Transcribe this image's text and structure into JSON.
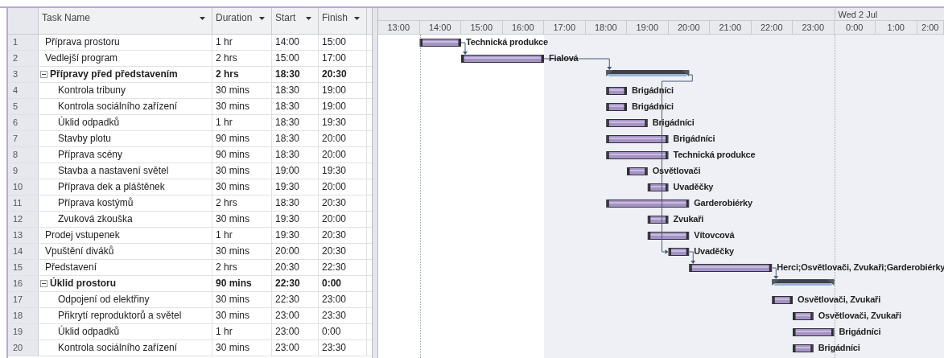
{
  "table": {
    "columns": [
      {
        "label": "Task Name",
        "filter": true
      },
      {
        "label": "Duration",
        "filter": true
      },
      {
        "label": "Start",
        "filter": true
      },
      {
        "label": "Finish",
        "filter": true
      }
    ]
  },
  "timescale": {
    "day_label": "Wed 2 Jul",
    "hours": [
      "13:00",
      "14:00",
      "15:00",
      "16:00",
      "17:00",
      "18:00",
      "19:00",
      "20:00",
      "21:00",
      "22:00",
      "23:00",
      "0:00",
      "1:00",
      "2:00"
    ]
  },
  "tasks": [
    {
      "id": "1",
      "name": "Příprava prostoru",
      "kind": "task",
      "duration": "1 hr",
      "start": "14:00",
      "finish": "15:00",
      "resources": "Technická produkce"
    },
    {
      "id": "2",
      "name": "Vedlejší program",
      "kind": "task",
      "linked": true,
      "duration": "2 hrs",
      "start": "15:00",
      "finish": "17:00",
      "resources": "Fialová"
    },
    {
      "id": "3",
      "name": "Přípravy před představením",
      "kind": "summary",
      "expanded": true,
      "linked": true,
      "duration": "2 hrs",
      "start": "18:30",
      "finish": "20:30",
      "children": [
        {
          "id": "4",
          "name": "Kontrola tribuny",
          "kind": "task",
          "duration": "30 mins",
          "start": "18:30",
          "finish": "19:00",
          "resources": "Brigádníci"
        },
        {
          "id": "5",
          "name": "Kontrola sociálního zařízení",
          "kind": "task",
          "duration": "30 mins",
          "start": "18:30",
          "finish": "19:00",
          "resources": "Brigádníci"
        },
        {
          "id": "6",
          "name": "Úklid odpadků",
          "kind": "task",
          "duration": "1 hr",
          "start": "18:30",
          "finish": "19:30",
          "resources": "Brigádníci"
        },
        {
          "id": "7",
          "name": "Stavby plotu",
          "kind": "task",
          "duration": "90 mins",
          "start": "18:30",
          "finish": "20:00",
          "resources": "Brigádníci"
        },
        {
          "id": "8",
          "name": "Příprava scény",
          "kind": "task",
          "duration": "90 mins",
          "start": "18:30",
          "finish": "20:00",
          "resources": "Technická produkce"
        },
        {
          "id": "9",
          "name": "Stavba a nastavení světel",
          "kind": "task",
          "duration": "30 mins",
          "start": "19:00",
          "finish": "19:30",
          "resources": "Osvětlovači"
        },
        {
          "id": "10",
          "name": "Příprava dek a pláštěnek",
          "kind": "task",
          "duration": "30 mins",
          "start": "19:30",
          "finish": "20:00",
          "resources": "Uvaděčky"
        },
        {
          "id": "11",
          "name": "Příprava kostýmů",
          "kind": "task",
          "duration": "2 hrs",
          "start": "18:30",
          "finish": "20:30",
          "resources": "Garderobiérky"
        },
        {
          "id": "12",
          "name": "Zvuková zkouška",
          "kind": "task",
          "duration": "30 mins",
          "start": "19:30",
          "finish": "20:00",
          "resources": "Zvukaři"
        }
      ]
    },
    {
      "id": "13",
      "name": "Prodej vstupenek",
      "kind": "task",
      "duration": "1 hr",
      "start": "19:30",
      "finish": "20:30",
      "resources": "Vítovcová"
    },
    {
      "id": "14",
      "name": "Vpuštění diváků",
      "kind": "task",
      "linked_to_group": true,
      "duration": "30 mins",
      "start": "20:00",
      "finish": "20:30",
      "resources": "Uvaděčky"
    },
    {
      "id": "15",
      "name": "Představení",
      "kind": "task",
      "linked": true,
      "duration": "2 hrs",
      "start": "20:30",
      "finish": "22:30",
      "resources": "Herci;Osvětlovači, Zvukaři;Garderobiérky"
    },
    {
      "id": "16",
      "name": "Úklid prostoru",
      "kind": "summary",
      "expanded": true,
      "linked": true,
      "duration": "90 mins",
      "start": "22:30",
      "finish": "0:00",
      "children": [
        {
          "id": "17",
          "name": "Odpojení od elektřiny",
          "kind": "task",
          "duration": "30 mins",
          "start": "22:30",
          "finish": "23:00",
          "resources": "Osvětlovači, Zvukaři"
        },
        {
          "id": "18",
          "name": "Přikrytí reproduktorů a světel",
          "kind": "task",
          "duration": "30 mins",
          "start": "23:00",
          "finish": "23:30",
          "resources": "Osvětlovači, Zvukaři"
        },
        {
          "id": "19",
          "name": "Úklid odpadků",
          "kind": "task",
          "duration": "1 hr",
          "start": "23:00",
          "finish": "0:00",
          "resources": "Brigádníci"
        },
        {
          "id": "20",
          "name": "Kontrola sociálního zařízení",
          "kind": "task",
          "duration": "30 mins",
          "start": "23:00",
          "finish": "23:30",
          "resources": "Brigádníci"
        }
      ]
    }
  ]
}
